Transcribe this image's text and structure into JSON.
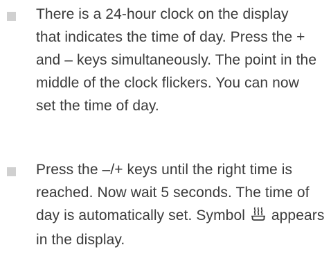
{
  "items": [
    {
      "lines": [
        "There is a 24-hour clock on the display",
        "that indicates the time of day. Press the +",
        "and – keys simultaneously. The point in the",
        "middle of the clock flickers. You can now",
        "set the time of day."
      ]
    },
    {
      "lines": [
        "Press the –/+ keys until the right time is",
        "reached. Now wait 5 seconds. The time of"
      ],
      "line3_before": "day is automatically set. Symbol ",
      "line3_icon": "cooking-pot-heat-icon",
      "line3_after": " appears",
      "line4": "in the display."
    }
  ]
}
